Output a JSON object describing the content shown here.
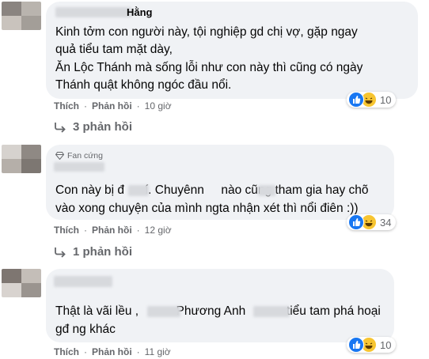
{
  "comments": [
    {
      "author": "Hằng",
      "badge": "",
      "lines": [
        "Kinh tởm con người này, tội nghiệp gd chị vợ, gặp ngay",
        "quả tiểu tam mặt dày,",
        "Ăn Lộc Thánh mà sống lỗi như con này thì cũng có ngày",
        "Thánh quật không ngóc đầu nổi."
      ],
      "reaction_count": "10",
      "like_label": "Thích",
      "reply_label": "Phản hồi",
      "time": "10 giờ",
      "replies_text": "3 phản hồi"
    },
    {
      "author": "",
      "badge": "Fan cứng",
      "lines": [
        "Con này bị đ      í. Chuyênn     nào cũng tham gia hay chõ",
        "vào xong chuyện của mình ngta nhận xét thì nổi điên :))"
      ],
      "reaction_count": "34",
      "like_label": "Thích",
      "reply_label": "Phản hồi",
      "time": "12 giờ",
      "replies_text": "1 phản hồi"
    },
    {
      "author": "",
      "badge": "",
      "lines": [
        "Thật là vãi lều ,           Phương Anh            tiểu tam phá hoại",
        "gđ ng khác"
      ],
      "reaction_count": "10",
      "like_label": "Thích",
      "reply_label": "Phản hồi",
      "time": "11 giờ",
      "replies_text": ""
    }
  ],
  "colors": {
    "bubble": "#f0f2f5",
    "like_blue": "#1877f2",
    "haha_yellow": "#f7c531",
    "meta_gray": "#65676b"
  },
  "icons": [
    "like-reaction-icon",
    "haha-reaction-icon",
    "reply-arrow-icon",
    "diamond-icon"
  ]
}
